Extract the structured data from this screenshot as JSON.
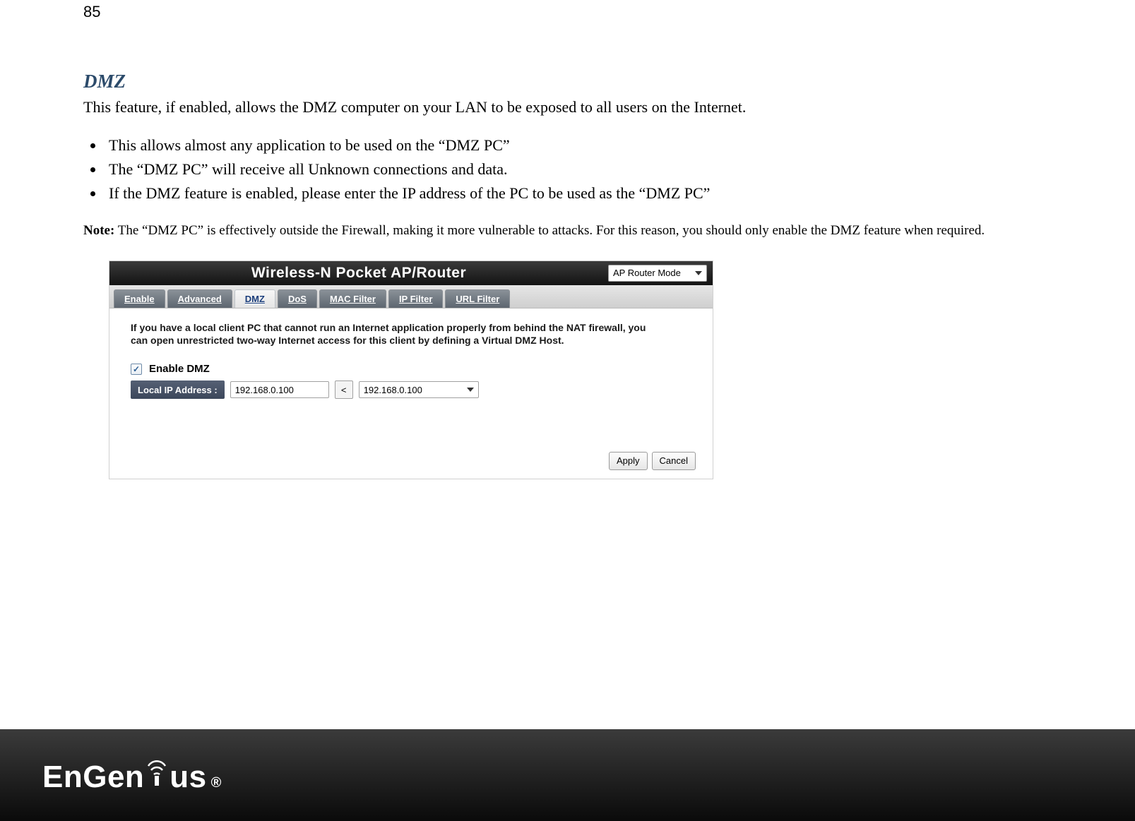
{
  "page_number": "85",
  "section_title": "DMZ",
  "intro": "This feature, if enabled, allows the DMZ computer on your LAN to be exposed to all users on the Internet.",
  "bullets": [
    "This allows almost any application to be used on the “DMZ PC”",
    "The “DMZ PC” will receive all Unknown connections and data.",
    "If the DMZ feature is enabled, please enter the IP address of the PC to be used as the “DMZ PC”"
  ],
  "note_label": "Note:",
  "note_text": " The “DMZ PC” is effectively outside the Firewall, making it more vulnerable to attacks. For this reason, you should only enable the DMZ feature when required.",
  "panel": {
    "banner_title": "Wireless-N Pocket AP/Router",
    "mode_value": "AP Router Mode",
    "tabs": [
      "Enable",
      "Advanced",
      "DMZ",
      "DoS",
      "MAC Filter",
      "IP Filter",
      "URL Filter"
    ],
    "active_tab_index": 2,
    "description": "If you have a local client PC that cannot run an Internet application properly from behind the NAT firewall, you can open unrestricted two-way Internet access for this client by defining a Virtual DMZ Host.",
    "enable_dmz_label": "Enable DMZ",
    "enable_dmz_checked": true,
    "ip_label": "Local IP Address :",
    "ip_value": "192.168.0.100",
    "copy_button_label": "<",
    "ip_select_value": "192.168.0.100",
    "apply_label": "Apply",
    "cancel_label": "Cancel"
  },
  "footer": {
    "logo_text_1": "EnGen",
    "logo_text_2": "us",
    "reg": "®"
  }
}
